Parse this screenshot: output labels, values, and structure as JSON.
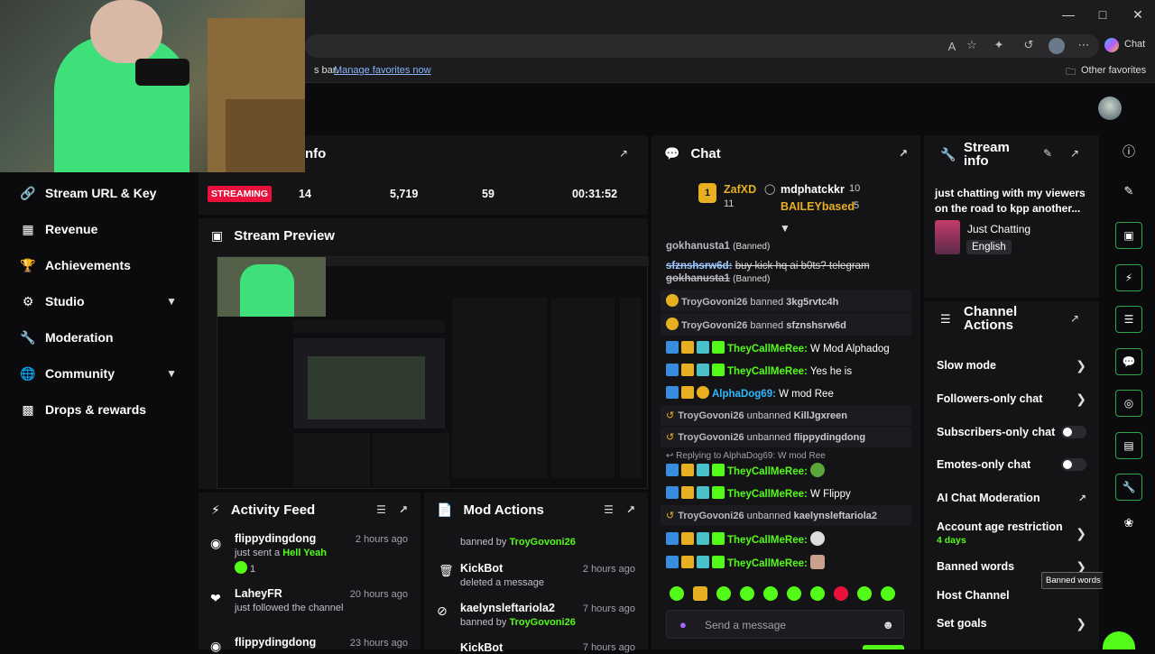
{
  "browser": {
    "chat_button": "Chat",
    "fav_bar_text": "s bar.",
    "fav_link": "Manage favorites now",
    "other_favorites": "Other favorites"
  },
  "sidebar": {
    "items": [
      {
        "label": "Stream URL & Key",
        "icon": "link-icon"
      },
      {
        "label": "Revenue",
        "icon": "chart-icon"
      },
      {
        "label": "Achievements",
        "icon": "trophy-icon"
      },
      {
        "label": "Studio",
        "icon": "studio-icon",
        "expandable": true
      },
      {
        "label": "Moderation",
        "icon": "wrench-icon"
      },
      {
        "label": "Community",
        "icon": "community-icon",
        "expandable": true
      },
      {
        "label": "Drops & rewards",
        "icon": "drops-icon"
      }
    ]
  },
  "session_info": {
    "title_fragment": "nfo",
    "status": "STREAMING",
    "stats": [
      "14",
      "5,719",
      "59",
      "00:31:52"
    ]
  },
  "preview": {
    "title": "Stream Preview"
  },
  "activity": {
    "title": "Activity Feed",
    "items": [
      {
        "name": "flippydingdong",
        "time": "2 hours ago",
        "sub_prefix": "just sent a",
        "sub_highlight": "Hell Yeah",
        "count": "1"
      },
      {
        "name": "LaheyFR",
        "time": "20 hours ago",
        "sub_prefix": "just followed the channel",
        "sub_highlight": "",
        "count": ""
      },
      {
        "name": "flippydingdong",
        "time": "23 hours ago",
        "sub_prefix": "",
        "sub_highlight": "",
        "count": ""
      }
    ]
  },
  "mod_actions": {
    "title": "Mod Actions",
    "top_line": "banned by",
    "top_mod": "TroyGovoni26",
    "items": [
      {
        "name": "KickBot",
        "time": "2 hours ago",
        "action": "deleted a message",
        "mod": ""
      },
      {
        "name": "kaelynsleftariola2",
        "time": "7 hours ago",
        "action": "banned by",
        "mod": "TroyGovoni26"
      },
      {
        "name": "KickBot",
        "time": "7 hours ago",
        "action": "",
        "mod": ""
      }
    ]
  },
  "chat": {
    "title": "Chat",
    "top_users": [
      {
        "name": "ZafXD",
        "count": "11"
      },
      {
        "name": "mdphatckkr",
        "count": "10"
      },
      {
        "name": "BAILEYbased",
        "count": "5"
      }
    ],
    "lines": {
      "l1_user": "gokhanusta1",
      "l1_tag": "(Banned)",
      "l2_user": "sfznshsrw6d:",
      "l2_msg": "buy kick hq ai b0ts? telegram",
      "l3_user": "gokhanusta1",
      "l3_tag": "(Banned)",
      "s1_mod": "TroyGovoni26",
      "s1_act": "banned",
      "s1_target": "3kg5rvtc4h",
      "s2_mod": "TroyGovoni26",
      "s2_act": "banned",
      "s2_target": "sfznshsrw6d",
      "m1_user": "TheyCallMeRee:",
      "m1_msg": "W Mod Alphadog",
      "m2_user": "TheyCallMeRee:",
      "m2_msg": "Yes he is",
      "m3_user": "AlphaDog69:",
      "m3_msg": "W mod Ree",
      "s3_mod": "TroyGovoni26",
      "s3_act": "unbanned",
      "s3_target": "KillJgxreen",
      "s4_mod": "TroyGovoni26",
      "s4_act": "unbanned",
      "s4_target": "flippydingdong",
      "reply_text": "Replying to AlphaDog69: W mod Ree",
      "m4_user": "TheyCallMeRee:",
      "m5_user": "TheyCallMeRee:",
      "m5_msg": "W Flippy",
      "s5_mod": "TroyGovoni26",
      "s5_act": "unbanned",
      "s5_target": "kaelynsleftariola2",
      "m6_user": "TheyCallMeRee:",
      "m7_user": "TheyCallMeRee:"
    },
    "input_placeholder": "Send a message"
  },
  "stream_info": {
    "title_line1": "Stream",
    "title_line2": "info",
    "description": "just chatting with my viewers on the road to kpp another...",
    "category": "Just Chatting",
    "language": "English"
  },
  "channel_actions": {
    "title_line1": "Channel",
    "title_line2": "Actions",
    "rows": {
      "slow": "Slow mode",
      "followers": "Followers-only chat",
      "subscribers": "Subscribers-only chat",
      "emotes": "Emotes-only chat",
      "ai": "AI Chat Moderation",
      "age": "Account age restriction",
      "age_sub": "4 days",
      "banned": "Banned words",
      "host": "Host Channel",
      "goals": "Set goals"
    },
    "tooltip": "Banned words"
  },
  "colors": {
    "accent": "#53fc18",
    "streaming": "#e9113c",
    "panel": "#141416"
  }
}
